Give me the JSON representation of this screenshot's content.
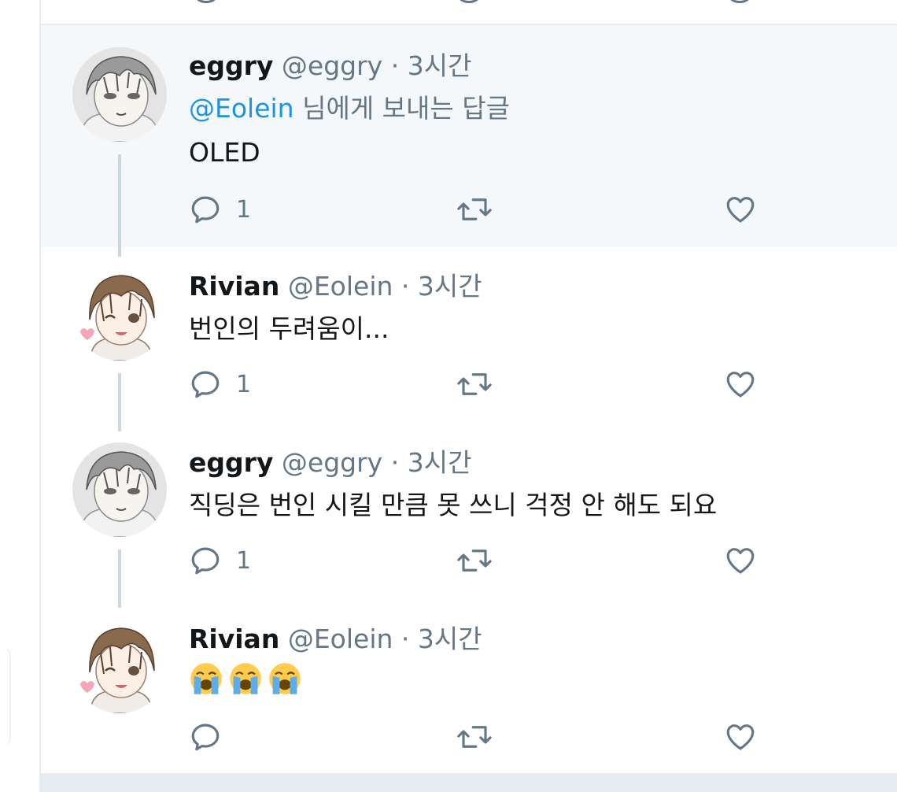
{
  "tweets": [
    {
      "name": "eggry",
      "handle": "@eggry",
      "separator": "·",
      "time": "3시간",
      "reply_mention": "@Eolein",
      "reply_suffix": " 님에게 보내는 답글",
      "text": "OLED",
      "reply_count": "1",
      "avatar": "grey-haired-character-avatar"
    },
    {
      "name": "Rivian",
      "handle": "@Eolein",
      "separator": "·",
      "time": "3시간",
      "text": "번인의 두려움이...",
      "reply_count": "1",
      "avatar": "brown-haired-character-avatar"
    },
    {
      "name": "eggry",
      "handle": "@eggry",
      "separator": "·",
      "time": "3시간",
      "text": "직딩은 번인 시킬 만큼 못 쓰니 걱정 안 해도 되요",
      "reply_count": "1",
      "avatar": "grey-haired-character-avatar"
    },
    {
      "name": "Rivian",
      "handle": "@Eolein",
      "separator": "·",
      "time": "3시간",
      "text_emojis": [
        "loudly-crying-face",
        "loudly-crying-face",
        "loudly-crying-face"
      ],
      "reply_count": "",
      "avatar": "brown-haired-character-avatar"
    }
  ],
  "icons": {
    "reply": "reply-icon",
    "retweet": "retweet-icon",
    "like": "heart-icon"
  },
  "colors": {
    "link": "#1b95e0",
    "secondary_text": "#657786",
    "highlight_background": "#f5f8fa",
    "thread_line": "#ccd6dd"
  }
}
